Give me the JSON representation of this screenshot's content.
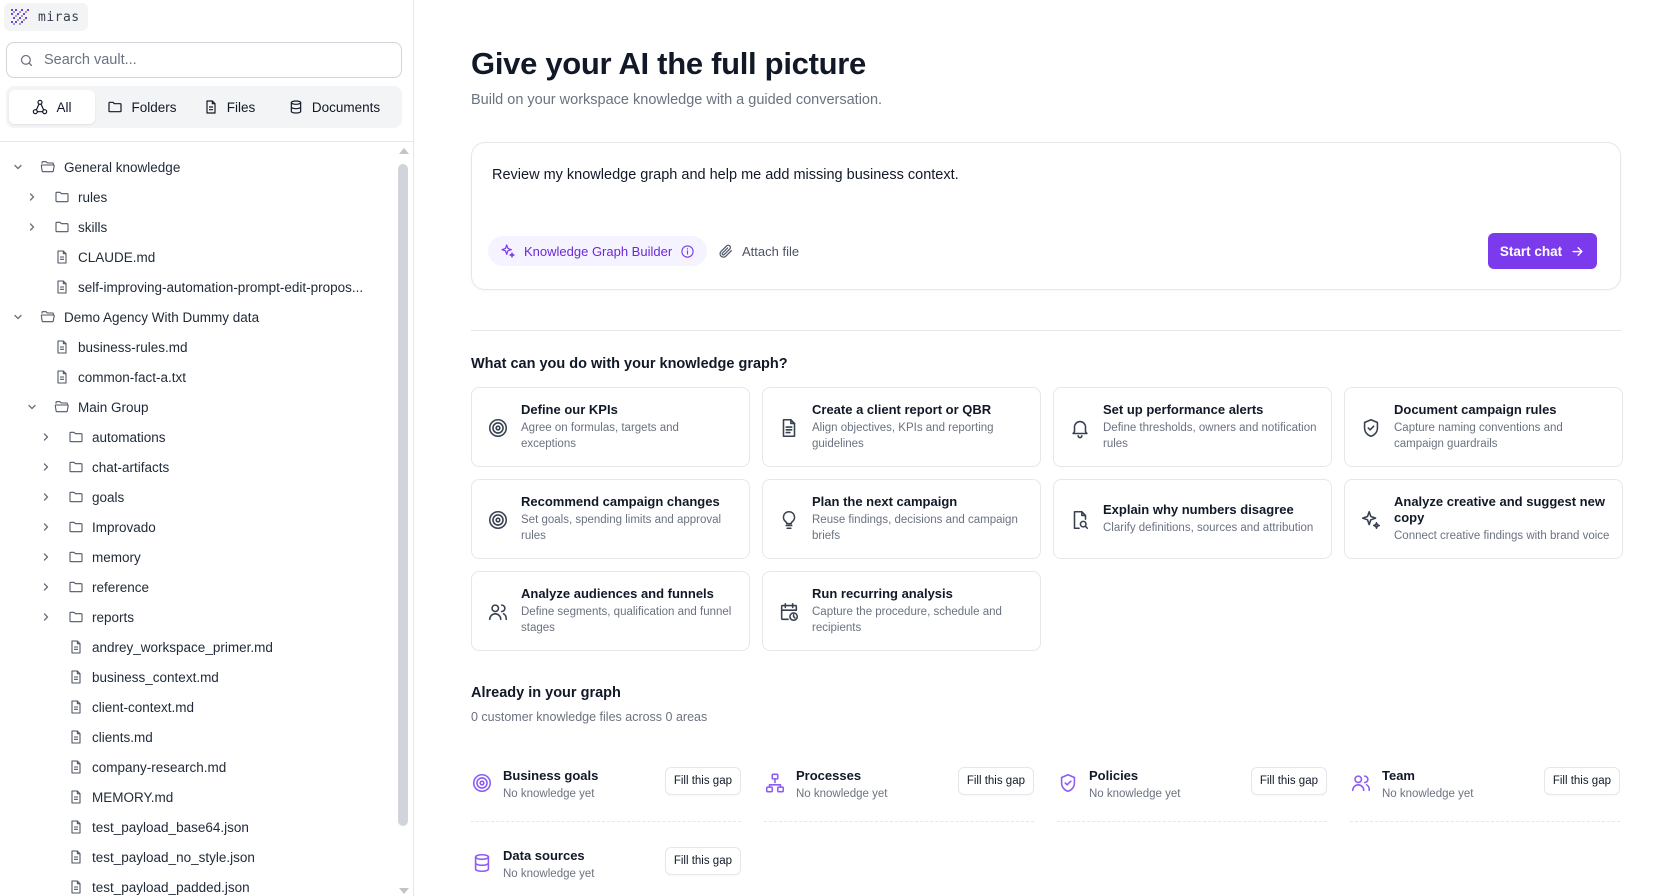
{
  "app": {
    "logo_text": "miras"
  },
  "sidebar": {
    "search": {
      "placeholder": "Search vault..."
    },
    "filter_tabs": [
      {
        "label": "All",
        "icon": "graph-icon",
        "active": true
      },
      {
        "label": "Folders",
        "icon": "folder-icon",
        "active": false
      },
      {
        "label": "Files",
        "icon": "file-icon",
        "active": false
      },
      {
        "label": "Documents",
        "icon": "database-icon",
        "active": false
      }
    ],
    "tree": [
      {
        "label": "General knowledge",
        "type": "folder",
        "depth": 0,
        "expanded": true
      },
      {
        "label": "rules",
        "type": "folder",
        "depth": 1,
        "expanded": false
      },
      {
        "label": "skills",
        "type": "folder",
        "depth": 1,
        "expanded": false
      },
      {
        "label": "CLAUDE.md",
        "type": "file",
        "depth": 1
      },
      {
        "label": "self-improving-automation-prompt-edit-propos...",
        "type": "file",
        "depth": 1
      },
      {
        "label": "Demo Agency With Dummy data",
        "type": "folder",
        "depth": 0,
        "expanded": true
      },
      {
        "label": "business-rules.md",
        "type": "file",
        "depth": 1
      },
      {
        "label": "common-fact-a.txt",
        "type": "file",
        "depth": 1
      },
      {
        "label": "Main Group",
        "type": "folder",
        "depth": 1,
        "expanded": true
      },
      {
        "label": "automations",
        "type": "folder",
        "depth": 2,
        "expanded": false
      },
      {
        "label": "chat-artifacts",
        "type": "folder",
        "depth": 2,
        "expanded": false
      },
      {
        "label": "goals",
        "type": "folder",
        "depth": 2,
        "expanded": false
      },
      {
        "label": "Improvado",
        "type": "folder",
        "depth": 2,
        "expanded": false
      },
      {
        "label": "memory",
        "type": "folder",
        "depth": 2,
        "expanded": false
      },
      {
        "label": "reference",
        "type": "folder",
        "depth": 2,
        "expanded": false
      },
      {
        "label": "reports",
        "type": "folder",
        "depth": 2,
        "expanded": false
      },
      {
        "label": "andrey_workspace_primer.md",
        "type": "file",
        "depth": 2
      },
      {
        "label": "business_context.md",
        "type": "file",
        "depth": 2
      },
      {
        "label": "client-context.md",
        "type": "file",
        "depth": 2
      },
      {
        "label": "clients.md",
        "type": "file",
        "depth": 2
      },
      {
        "label": "company-research.md",
        "type": "file",
        "depth": 2
      },
      {
        "label": "MEMORY.md",
        "type": "file",
        "depth": 2
      },
      {
        "label": "test_payload_base64.json",
        "type": "file",
        "depth": 2
      },
      {
        "label": "test_payload_no_style.json",
        "type": "file",
        "depth": 2
      },
      {
        "label": "test_payload_padded.json",
        "type": "file",
        "depth": 2
      }
    ]
  },
  "main": {
    "title": "Give your AI the full picture",
    "subtitle": "Build on your workspace knowledge with a guided conversation.",
    "composer": {
      "text": "Review my knowledge graph and help me add missing business context.",
      "mode_label": "Knowledge Graph Builder",
      "attach_label": "Attach file",
      "start_label": "Start chat"
    },
    "actions_title": "What can you do with your knowledge graph?",
    "actions": [
      {
        "title": "Define our KPIs",
        "desc": "Agree on formulas, targets and exceptions",
        "icon": "target-icon"
      },
      {
        "title": "Create a client report or QBR",
        "desc": "Align objectives, KPIs and reporting guidelines",
        "icon": "document-icon"
      },
      {
        "title": "Set up performance alerts",
        "desc": "Define thresholds, owners and notification rules",
        "icon": "bell-icon"
      },
      {
        "title": "Document campaign rules",
        "desc": "Capture naming conventions and campaign guardrails",
        "icon": "shield-check-icon"
      },
      {
        "title": "Recommend campaign changes",
        "desc": "Set goals, spending limits and approval rules",
        "icon": "target-icon"
      },
      {
        "title": "Plan the next campaign",
        "desc": "Reuse findings, decisions and campaign briefs",
        "icon": "lightbulb-icon"
      },
      {
        "title": "Explain why numbers disagree",
        "desc": "Clarify definitions, sources and attribution",
        "icon": "file-search-icon"
      },
      {
        "title": "Analyze creative and suggest new copy",
        "desc": "Connect creative findings with brand voice",
        "icon": "sparkles-icon"
      },
      {
        "title": "Analyze audiences and funnels",
        "desc": "Define segments, qualification and funnel stages",
        "icon": "users-icon"
      },
      {
        "title": "Run recurring analysis",
        "desc": "Capture the procedure, schedule and recipients",
        "icon": "calendar-clock-icon"
      }
    ],
    "graph": {
      "title": "Already in your graph",
      "subtitle": "0 customer knowledge files across 0 areas",
      "areas": [
        {
          "title": "Business goals",
          "desc": "No knowledge yet",
          "button": "Fill this gap",
          "icon": "target-icon"
        },
        {
          "title": "Processes",
          "desc": "No knowledge yet",
          "button": "Fill this gap",
          "icon": "workflow-icon"
        },
        {
          "title": "Policies",
          "desc": "No knowledge yet",
          "button": "Fill this gap",
          "icon": "shield-check-icon"
        },
        {
          "title": "Team",
          "desc": "No knowledge yet",
          "button": "Fill this gap",
          "icon": "users-icon"
        },
        {
          "title": "Data sources",
          "desc": "No knowledge yet",
          "button": "Fill this gap",
          "icon": "database-icon"
        }
      ]
    }
  },
  "colors": {
    "accent": "#7c3aed",
    "accent_soft": "#f5f3ff",
    "border": "#e5e7eb",
    "muted_text": "#6b7280"
  }
}
